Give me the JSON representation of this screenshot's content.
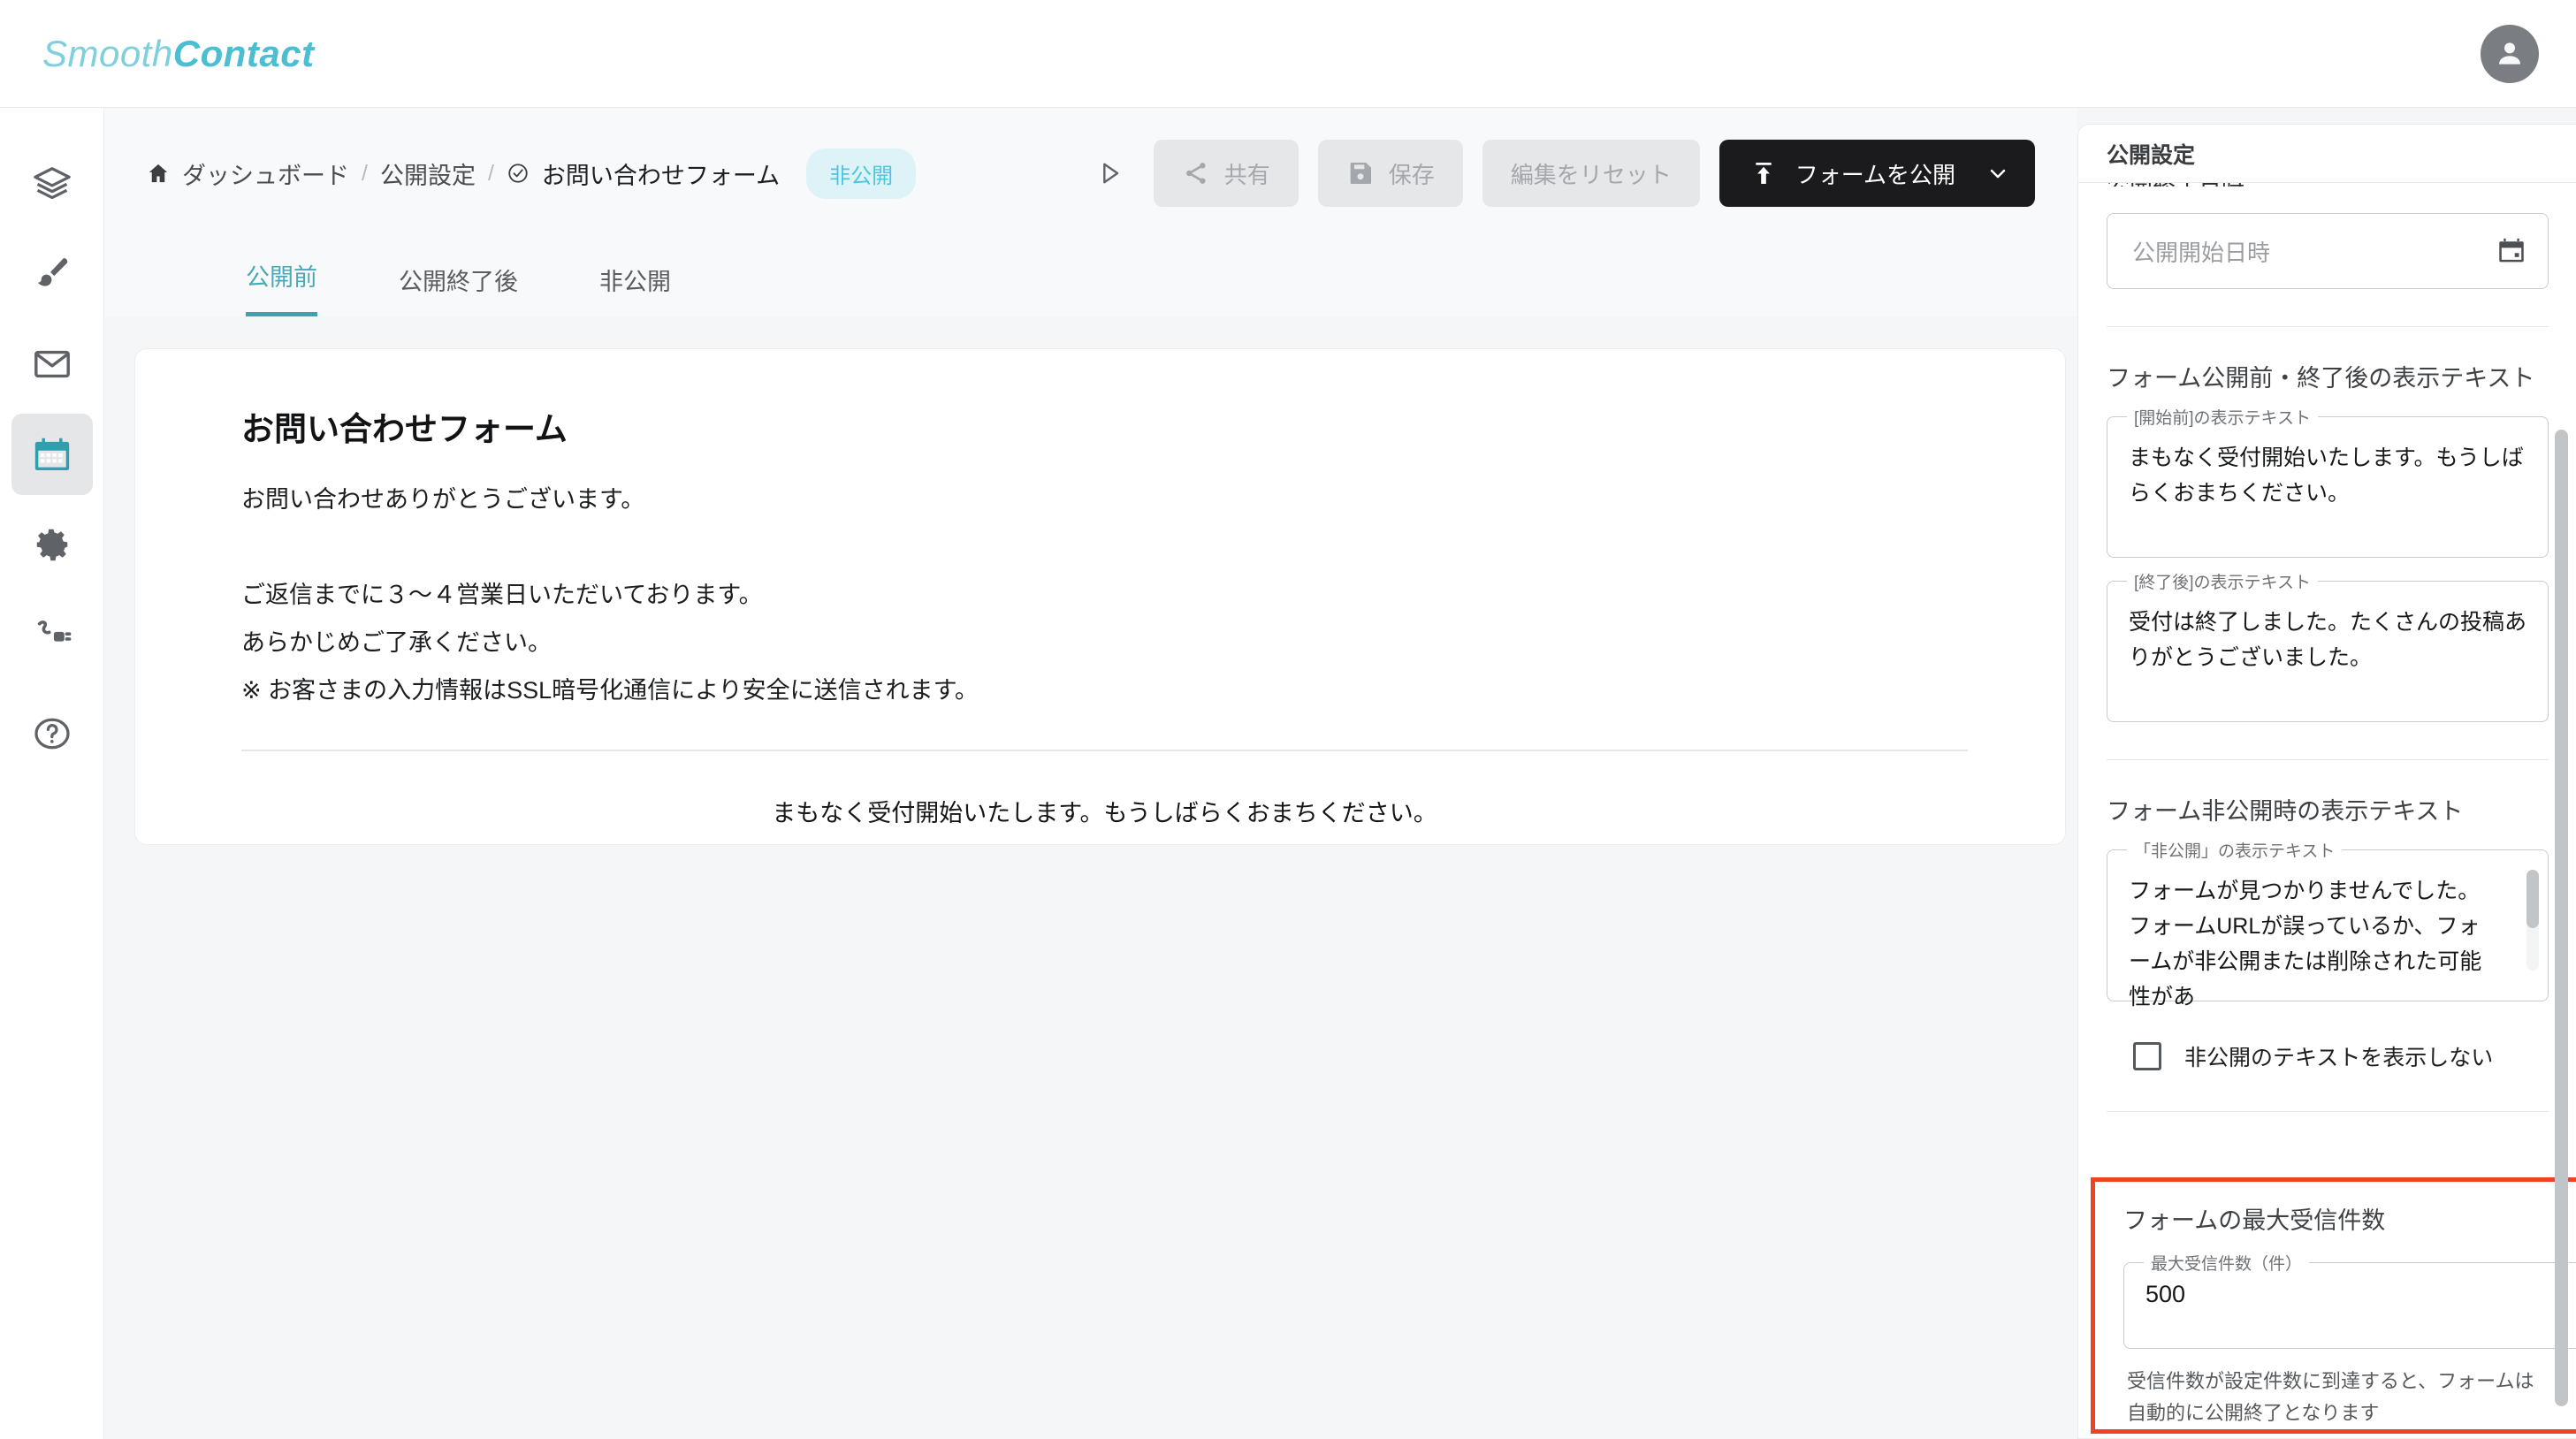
{
  "app": {
    "logo_primary": "Smooth",
    "logo_secondary": "Contact",
    "accent_color": "#4cbed2",
    "active_color": "#3fa1ae",
    "highlight_color": "#f04322",
    "background_color": "#f4f6f8"
  },
  "topbar": {
    "avatar_name": "account-avatar"
  },
  "sidebar": {
    "items": [
      {
        "name": "layers",
        "label": "layers-icon",
        "active": false
      },
      {
        "name": "brush",
        "label": "brush-icon",
        "active": false
      },
      {
        "name": "mail",
        "label": "mail-icon",
        "active": false
      },
      {
        "name": "calendar",
        "label": "calendar-icon",
        "active": true
      },
      {
        "name": "settings",
        "label": "gear-icon",
        "active": false
      },
      {
        "name": "integration",
        "label": "power-plug-icon",
        "active": false
      },
      {
        "name": "help",
        "label": "help-circle-icon",
        "active": false
      }
    ]
  },
  "breadcrumb": {
    "home_icon": "home-icon",
    "dashboard": "ダッシュボード",
    "separator": "/",
    "settings": "公開設定",
    "current_icon": "check-circle-icon",
    "current": "お問い合わせフォーム",
    "status_badge": "非公開"
  },
  "toolbar": {
    "preview_icon": "play-icon",
    "share_label": "共有",
    "save_label": "保存",
    "reset_label": "編集をリセット",
    "publish_label": "フォームを公開"
  },
  "tabs": [
    {
      "label": "公開前",
      "active": true
    },
    {
      "label": "公開終了後",
      "active": false
    },
    {
      "label": "非公開",
      "active": false
    }
  ],
  "preview": {
    "title": "お問い合わせフォーム",
    "line1": "お問い合わせありがとうございます。",
    "line2": "ご返信までに３〜４営業日いただいております。",
    "line3": "あらかじめご了承ください。",
    "line4": "※ お客さまの入力情報はSSL暗号化通信により安全に送信されます。",
    "message": "まもなく受付開始いたします。もうしばらくおまちください。"
  },
  "panel": {
    "title": "公開設定",
    "scrolled_label": "公開終了日時",
    "start_date": {
      "placeholder": "公開開始日時",
      "value": "",
      "calendar_icon": "calendar-icon"
    },
    "display_text_section": {
      "title": "フォーム公開前・終了後の表示テキスト",
      "before_label": "[開始前]の表示テキスト",
      "before_value": "まもなく受付開始いたします。もうしばらくおまちください。",
      "after_label": "[終了後]の表示テキスト",
      "after_value": "受付は終了しました。たくさんの投稿ありがとうございました。"
    },
    "private_text_section": {
      "title": "フォーム非公開時の表示テキスト",
      "private_label": "「非公開」の表示テキスト",
      "private_value": "フォームが見つかりませんでした。フォームURLが誤っているか、フォームが非公開または削除された可能性があ",
      "checkbox_label": "非公開のテキストを表示しない",
      "checkbox_checked": false
    },
    "max_receive_section": {
      "title": "フォームの最大受信件数",
      "field_label": "最大受信件数（件）",
      "value": "500",
      "helper_line1": "受信件数が設定件数に到達すると、フォームは",
      "helper_line2": "自動的に公開終了となります"
    }
  }
}
